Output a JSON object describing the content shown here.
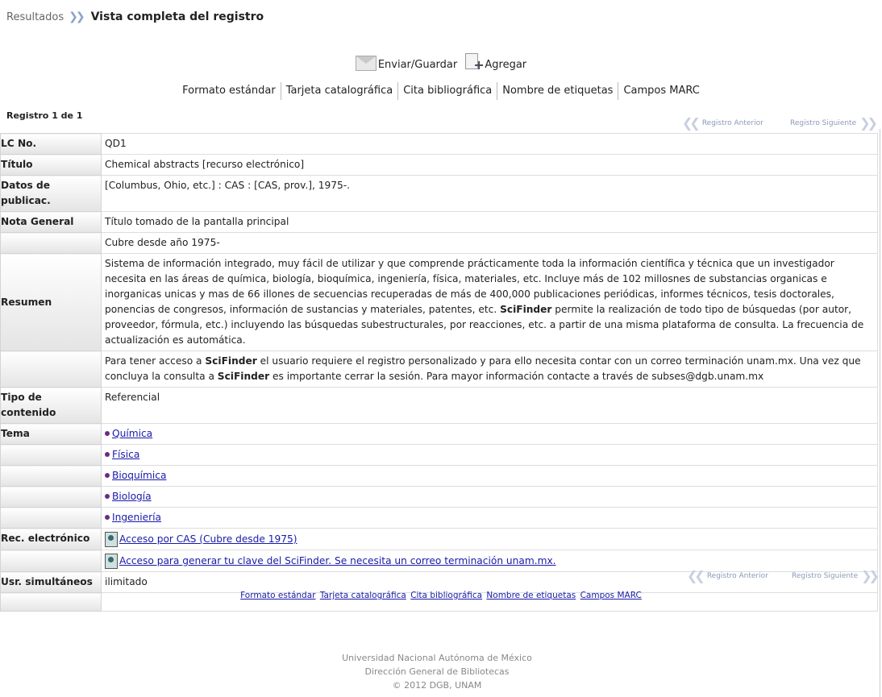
{
  "breadcrumb": {
    "results": "Resultados",
    "current": "Vista completa del registro"
  },
  "actions": {
    "send": "Enviar/Guardar",
    "add": "Agregar"
  },
  "formats": [
    "Formato estándar",
    "Tarjeta catalográfica",
    "Cita bibliográfica",
    "Nombre de etiquetas",
    "Campos MARC"
  ],
  "record_count": "Registro 1 de 1",
  "nav": {
    "prev": "Registro Anterior",
    "next": "Registro Siguiente"
  },
  "record": {
    "lc_label": "LC No.",
    "lc": "QD1",
    "title_label": "Título",
    "title": "Chemical abstracts [recurso electrónico]",
    "pub_label": "Datos de publicac.",
    "pub": "[Columbus, Ohio, etc.] : CAS : [CAS, prov.], 1975-.",
    "note_label": "Nota General",
    "note1": "Título tomado de la pantalla principal",
    "note2": "Cubre desde año 1975-",
    "summary_label": "Resumen",
    "summary_a": "Sistema de información integrado, muy fácil de utilizar y que comprende prácticamente toda la información científica y técnica que un investigador necesita en las áreas de química, biología, bioquímica, ingeniería, física, materiales, etc. Incluye más de 102 millosnes de substancias organicas e inorganicas unicas y mas de 66 illones de secuencias recuperadas de más de 400,000 publicaciones periódicas, informes técnicos, tesis doctorales, ponencias de congresos, información de sustancias y materiales, patentes, etc. ",
    "summary_bold": "SciFinder",
    "summary_b": " permite la realización de todo tipo de búsquedas (por autor, proveedor, fórmula, etc.) incluyendo las búsquedas subestructurales, por reacciones, etc. a partir de una misma plataforma de consulta. La frecuencia de actualización es automática.",
    "access_a": "Para tener acceso a ",
    "access_bold1": "SciFinder",
    "access_b": " el usuario requiere el registro personalizado y para ello necesita contar con un correo terminación unam.mx. Una vez que concluya la consulta a ",
    "access_bold2": "SciFinder",
    "access_c": " es importante cerrar la sesión. Para mayor información contacte a través de subses@dgb.unam.mx",
    "content_label": "Tipo de contenido",
    "content": "Referencial",
    "topic_label": "Tema",
    "topics": [
      "Química",
      "Física",
      "Bioquímica",
      "Biología",
      "Ingeniería"
    ],
    "erec_label": "Rec. electrónico",
    "erec1": "Acceso por CAS (Cubre desde 1975) ",
    "erec2": "Acceso para generar tu clave del SciFinder. Se necesita un correo terminación unam.mx. ",
    "users_label": "Usr. simultáneos",
    "users": "ilimitado"
  },
  "footer": {
    "line1": "Universidad Nacional Autónoma de México",
    "line2": "Dirección General de Bibliotecas",
    "line3": "© 2012 DGB, UNAM"
  },
  "icons": {
    "chevrons": "double-chevron-right-icon",
    "send": "envelope-icon",
    "add": "add-document-icon",
    "link": "web-resource-icon",
    "bullet": "bullet-icon"
  },
  "colors": {
    "link": "#1a1aaa",
    "bullet": "#6a2a88",
    "label_bg": "#e4e4e4"
  }
}
